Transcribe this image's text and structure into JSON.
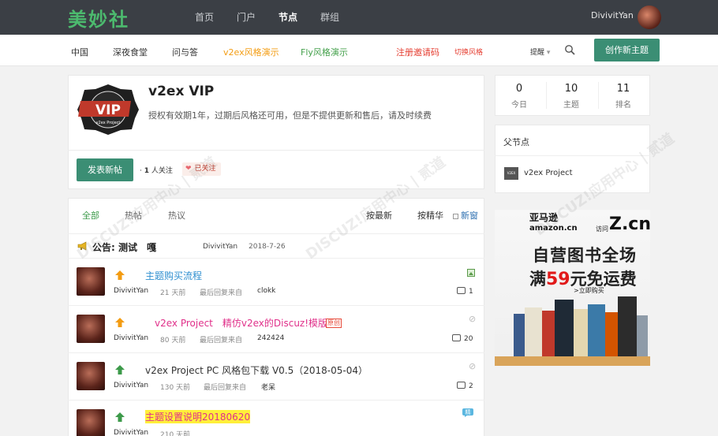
{
  "topbar": {
    "logo": "美妙社",
    "nav": [
      "首页",
      "门户",
      "节点",
      "群组"
    ],
    "active_nav": "节点",
    "username": "DivivitYan"
  },
  "subnav": {
    "items": [
      {
        "label": "中国",
        "style": "normal"
      },
      {
        "label": "深夜食堂",
        "style": "normal"
      },
      {
        "label": "问与答",
        "style": "normal"
      },
      {
        "label": "v2ex风格演示",
        "style": "orange"
      },
      {
        "label": "Fly风格演示",
        "style": "green"
      },
      {
        "label": "注册邀请码",
        "style": "red"
      },
      {
        "label": "切换风格",
        "style": "red-small"
      }
    ],
    "remind": "提醒",
    "create_button": "创作新主题"
  },
  "node": {
    "badge_text": "VIP",
    "badge_subtext": "v2ex Project",
    "title": "v2ex VIP",
    "description": "授权有效期1年，过期后风格还可用，但是不提供更新和售后，请及时续费",
    "post_button": "发表新帖",
    "follow_count": "1",
    "follow_suffix": "人关注",
    "followed_label": "已关注"
  },
  "tabs": {
    "left": [
      "全部",
      "热帖",
      "热议"
    ],
    "active": "全部",
    "right": [
      "按最新",
      "按精华"
    ],
    "new_window": "新窗"
  },
  "announcement": {
    "title": "公告: 测试　嘎",
    "author": "DivivitYan",
    "date": "2018-7-26"
  },
  "threads": [
    {
      "title": "主题购买流程",
      "title_color": "#2f8fd0",
      "highlight": false,
      "arrow_color": "#f39c12",
      "author": "DivivitYan",
      "time": "21 天前",
      "last_label": "最后回复来自",
      "last_user": "clokk",
      "replies": "1",
      "badge": "",
      "right_icon": "image-icon"
    },
    {
      "title": "v2ex Project　精仿v2ex的Discuz!模版",
      "title_color": "#e0308a",
      "highlight": false,
      "arrow_color": "#f39c12",
      "author": "DivivitYan",
      "time": "80 天前",
      "last_label": "最后回复来自",
      "last_user": "242424",
      "replies": "20",
      "badge": "原创",
      "right_icon": "paperclip-icon"
    },
    {
      "title": "v2ex Project PC 风格包下载 V0.5（2018-05-04）",
      "title_color": "#333333",
      "highlight": false,
      "arrow_color": "#3c9a4a",
      "author": "DivivitYan",
      "time": "130 天前",
      "last_label": "最后回复来自",
      "last_user": "老呆",
      "replies": "2",
      "badge": "",
      "right_icon": "paperclip-icon"
    },
    {
      "title": "主题设置说明20180620",
      "title_color": "#e0308a",
      "highlight": true,
      "arrow_color": "#3c9a4a",
      "author": "DivivitYan",
      "time": "210 天前",
      "last_label": "",
      "last_user": "",
      "replies": "",
      "badge": "",
      "right_icon": "essence-icon"
    }
  ],
  "stats": [
    {
      "value": "0",
      "label": "今日"
    },
    {
      "value": "10",
      "label": "主题"
    },
    {
      "value": "11",
      "label": "排名"
    }
  ],
  "parent": {
    "label": "父节点",
    "icon_text": "V2EX",
    "name": "v2ex Project"
  },
  "ad": {
    "brand": "亚马逊",
    "brand_en": "amazon.cn",
    "visit": "访问",
    "domain": "Z.cn",
    "line1": "自营图书全场",
    "line2_prefix": "满",
    "line2_num": "59",
    "line2_suffix": "元免运费",
    "buy": ">立即购买"
  },
  "watermark": "DISCUZ!应用中心 | 贰道"
}
